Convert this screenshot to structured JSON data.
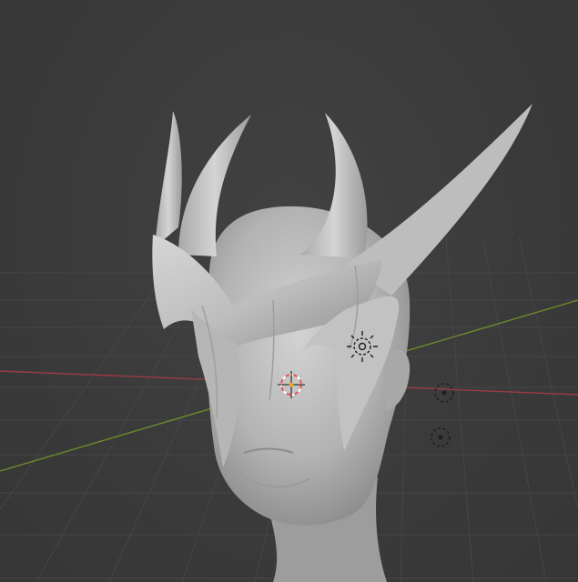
{
  "viewport": {
    "background": "#3b3b3b",
    "grid_color": "#474747",
    "x_axis_color": "#9a3b45",
    "y_axis_color": "#6b8a2e"
  },
  "scene": {
    "objects": [
      {
        "name": "head",
        "icon": "mannequin-head",
        "color": "#bdbdbd"
      },
      {
        "name": "helmet",
        "icon": "horned-helmet",
        "color": "#c4c4c4"
      }
    ],
    "gizmos": [
      "3d-cursor-icon",
      "light-gizmo-icon",
      "empty-gizmo-icon",
      "empty-gizmo-icon"
    ]
  }
}
